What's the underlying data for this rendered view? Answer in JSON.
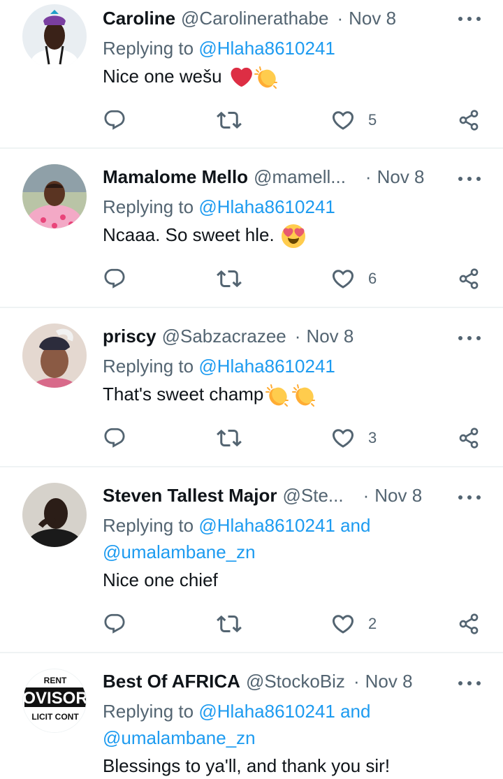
{
  "tweets": [
    {
      "name": "Caroline",
      "handle": "@Carolinerathabe",
      "dot": "·",
      "date": "Nov 8",
      "reply_label": "Replying to",
      "mention1": "@Hlaha8610241",
      "mention_join": "",
      "mention2": "",
      "text": "Nice one wešu",
      "emojis": [
        "red-heart",
        "clapping-hands"
      ],
      "likes": "5"
    },
    {
      "name": "Mamalome Mello",
      "handle": "@mamell...",
      "dot": "·",
      "date": "Nov 8",
      "reply_label": "Replying to",
      "mention1": "@Hlaha8610241",
      "mention_join": "",
      "mention2": "",
      "text": "Ncaaa. So sweet hle.",
      "emojis": [
        "heart-eyes"
      ],
      "likes": "6"
    },
    {
      "name": "priscy",
      "handle": "@Sabzacrazee",
      "dot": "·",
      "date": "Nov 8",
      "reply_label": "Replying to",
      "mention1": "@Hlaha8610241",
      "mention_join": "",
      "mention2": "",
      "text": "That's sweet champ",
      "emojis": [
        "clapping-hands",
        "clapping-hands"
      ],
      "likes": "3"
    },
    {
      "name": "Steven Tallest Major",
      "handle": "@Ste...",
      "dot": "·",
      "date": "Nov 8",
      "reply_label": "Replying to",
      "mention1": "@Hlaha8610241",
      "mention_join": "and",
      "mention2": "@umalambane_zn",
      "text": "Nice one chief",
      "emojis": [],
      "likes": "2"
    },
    {
      "name": "Best Of AFRICA",
      "handle": "@StockoBiz",
      "dot": "·",
      "date": "Nov 8",
      "reply_label": "Replying to",
      "mention1": "@Hlaha8610241",
      "mention_join": "and",
      "mention2": "@umalambane_zn",
      "text": "Blessings to ya'll, and thank you sir!",
      "emojis": [],
      "likes": ""
    }
  ],
  "avatar5_logo_text": [
    "RENT",
    "OVISOR",
    "LICIT CONT"
  ],
  "colors": {
    "text": "#0f1419",
    "secondary": "#536471",
    "link": "#1d9bf0",
    "divider": "#eff3f4"
  }
}
